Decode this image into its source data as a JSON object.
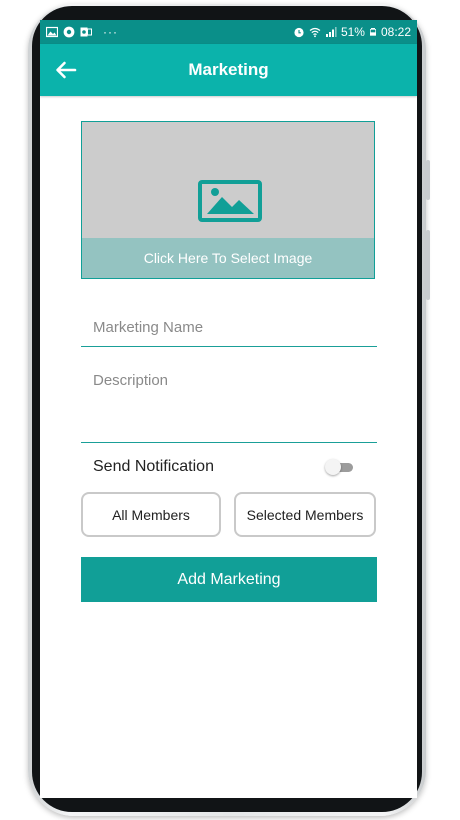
{
  "status_bar": {
    "left_icons": [
      "gallery-icon",
      "browser-icon",
      "outlook-icon"
    ],
    "more": "···",
    "battery_percent": "51%",
    "time": "08:22"
  },
  "app_bar": {
    "title": "Marketing",
    "back_icon": "arrow-left-icon"
  },
  "image_picker": {
    "icon": "image-icon",
    "caption": "Click Here To Select Image"
  },
  "form": {
    "name_placeholder": "Marketing Name",
    "description_placeholder": "Description",
    "send_notification_label": "Send Notification",
    "send_notification_on": false
  },
  "audience_buttons": {
    "all_members": "All Members",
    "selected_members": "Selected Members"
  },
  "submit_button": "Add Marketing",
  "colors": {
    "status_bar": "#0a8f89",
    "app_bar": "#0bb3ab",
    "accent": "#119f97",
    "image_placeholder": "#cccccc",
    "caption_bg": "#94c3c1"
  }
}
